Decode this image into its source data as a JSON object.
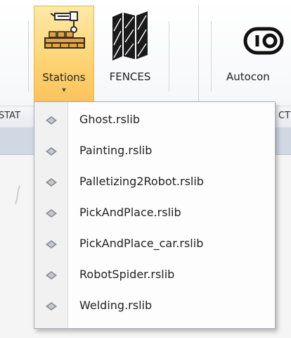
{
  "ribbon": {
    "stations_label": "Stations",
    "stations_caret": "▾",
    "fences_label": "FENCES",
    "auto_label": "Autocon",
    "icons": {
      "stations": "robot-station-icon",
      "fences": "fence-icon",
      "auto": "toggle-switch-icon"
    }
  },
  "groups": {
    "left_label": "STAT",
    "right_label": "CT"
  },
  "menu": {
    "item_icon": "library-file-icon",
    "items": [
      {
        "label": "Ghost.rslib"
      },
      {
        "label": "Painting.rslib"
      },
      {
        "label": "Palletizing2Robot.rslib"
      },
      {
        "label": "PickAndPlace.rslib"
      },
      {
        "label": "PickAndPlace_car.rslib"
      },
      {
        "label": "RobotSpider.rslib"
      },
      {
        "label": "Welding.rslib"
      }
    ]
  },
  "colors": {
    "highlight_top": "#fde9a8",
    "highlight_bottom": "#fbc35b",
    "menu_border": "#a8acb3",
    "icon_gray": "#8a8f94"
  }
}
